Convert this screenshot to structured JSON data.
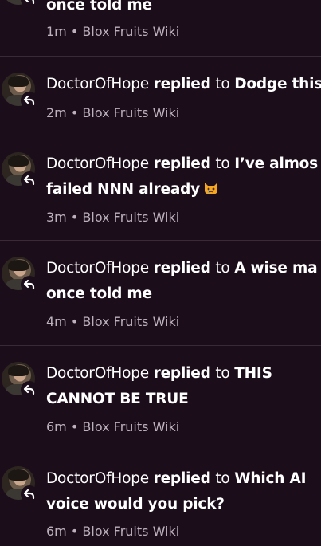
{
  "items": [
    {
      "title_line1": "once told me",
      "time": "1m",
      "sep": "•",
      "site": "Blox Fruits Wiki"
    },
    {
      "user": "DoctorOfHope",
      "action": "replied",
      "to": "to",
      "title": "Dodge this",
      "time": "2m",
      "sep": "•",
      "site": "Blox Fruits Wiki"
    },
    {
      "user": "DoctorOfHope",
      "action": "replied",
      "to": "to",
      "title_line1": "I’ve almos",
      "title_line2": "failed NNN already",
      "emoji_name": "crying-cat-emoji",
      "time": "3m",
      "sep": "•",
      "site": "Blox Fruits Wiki"
    },
    {
      "user": "DoctorOfHope",
      "action": "replied",
      "to": "to",
      "title_line1": "A wise ma",
      "title_line2": "once told me",
      "time": "4m",
      "sep": "•",
      "site": "Blox Fruits Wiki"
    },
    {
      "user": "DoctorOfHope",
      "action": "replied",
      "to": "to",
      "title_line1": "THIS",
      "title_line2": "CANNOT BE TRUE",
      "time": "6m",
      "sep": "•",
      "site": "Blox Fruits Wiki"
    },
    {
      "user": "DoctorOfHope",
      "action": "replied",
      "to": "to",
      "title_line1": "Which AI",
      "title_line2": "voice would you pick?",
      "time": "6m",
      "sep": "•",
      "site": "Blox Fruits Wiki"
    }
  ],
  "icons": {
    "avatar": "user-avatar",
    "badge": "reply-arrow-icon"
  },
  "colors": {
    "background": "#1c0d1b",
    "divider": "#3a2a38",
    "meta_text": "#bdb1bd",
    "text": "#ffffff"
  }
}
